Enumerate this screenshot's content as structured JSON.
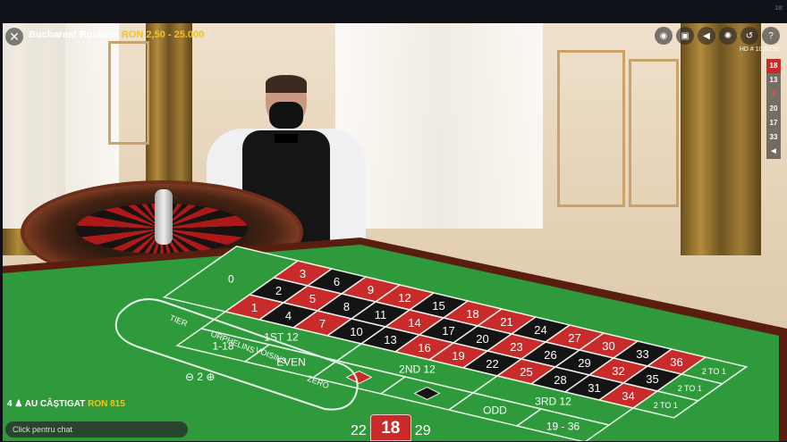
{
  "header": {
    "title": "Bucharest Roulette",
    "limits": "RON 2,50 - 25.000",
    "clock_corner": "18:"
  },
  "toolbar": {
    "icons": [
      "chips-icon",
      "camera-icon",
      "sound-icon",
      "settings-icon",
      "history-icon",
      "help-icon"
    ],
    "quality": "HD",
    "time": "# 10:50:51"
  },
  "history": [
    {
      "value": "18",
      "color": "red",
      "latest": true
    },
    {
      "value": "13",
      "color": "black"
    },
    {
      "value": "3",
      "color": "red"
    },
    {
      "value": "20",
      "color": "black"
    },
    {
      "value": "17",
      "color": "black"
    },
    {
      "value": "33",
      "color": "black"
    }
  ],
  "table_layout": {
    "zero": "0",
    "rows": [
      [
        "3",
        "6",
        "9",
        "12",
        "15",
        "18",
        "21",
        "24",
        "27",
        "30",
        "33",
        "36"
      ],
      [
        "2",
        "5",
        "8",
        "11",
        "14",
        "17",
        "20",
        "23",
        "26",
        "29",
        "32",
        "35"
      ],
      [
        "1",
        "4",
        "7",
        "10",
        "13",
        "16",
        "19",
        "22",
        "25",
        "28",
        "31",
        "34"
      ]
    ],
    "red_numbers": [
      1,
      3,
      5,
      7,
      9,
      12,
      14,
      16,
      18,
      19,
      21,
      23,
      25,
      27,
      30,
      32,
      34,
      36
    ],
    "dozens": [
      "1ST 12",
      "2ND 12",
      "3RD 12"
    ],
    "outside": [
      "1-18",
      "EVEN",
      "ODD",
      "19 - 36"
    ],
    "columns": [
      "2 TO 1",
      "2 TO 1",
      "2 TO 1"
    ],
    "racetrack": [
      "TIER",
      "ORPHELINS",
      "VOISINS",
      "ZERO"
    ],
    "neighbours": "2"
  },
  "winners": {
    "count": "4",
    "label": "AU CÂȘTIGAT",
    "amount": "RON 815"
  },
  "chat": {
    "placeholder": "Click pentru chat"
  },
  "result": {
    "previous": "22",
    "current": "18",
    "next": "29"
  },
  "colors": {
    "felt": "#2f9a3c",
    "red": "#c92b2b",
    "black": "#141414",
    "gold": "#f2c318"
  }
}
